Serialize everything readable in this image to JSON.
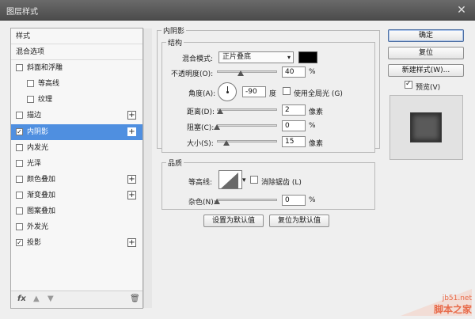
{
  "window": {
    "title": "图层样式",
    "close_icon": "close-icon"
  },
  "sidebar": {
    "items": [
      {
        "label": "样式",
        "has_checkbox": false,
        "checked": false,
        "has_plus": false
      },
      {
        "label": "混合选项",
        "has_checkbox": false,
        "checked": false,
        "has_plus": false
      },
      {
        "label": "斜面和浮雕",
        "has_checkbox": true,
        "checked": false,
        "has_plus": false
      },
      {
        "label": "等高线",
        "has_checkbox": true,
        "checked": false,
        "has_plus": false
      },
      {
        "label": "纹理",
        "has_checkbox": true,
        "checked": false,
        "has_plus": false
      },
      {
        "label": "描边",
        "has_checkbox": true,
        "checked": false,
        "has_plus": true
      },
      {
        "label": "内阴影",
        "has_checkbox": true,
        "checked": true,
        "has_plus": true
      },
      {
        "label": "内发光",
        "has_checkbox": true,
        "checked": false,
        "has_plus": false
      },
      {
        "label": "光泽",
        "has_checkbox": true,
        "checked": false,
        "has_plus": false
      },
      {
        "label": "颜色叠加",
        "has_checkbox": true,
        "checked": false,
        "has_plus": true
      },
      {
        "label": "渐变叠加",
        "has_checkbox": true,
        "checked": false,
        "has_plus": true
      },
      {
        "label": "图案叠加",
        "has_checkbox": true,
        "checked": false,
        "has_plus": false
      },
      {
        "label": "外发光",
        "has_checkbox": true,
        "checked": false,
        "has_plus": false
      },
      {
        "label": "投影",
        "has_checkbox": true,
        "checked": true,
        "has_plus": true
      }
    ],
    "footer": {
      "fx": "fx",
      "up": "▲",
      "down": "▼",
      "trash": "🗑"
    }
  },
  "inner_shadow": {
    "title": "内阴影",
    "structure_title": "结构",
    "blend_mode_label": "混合模式:",
    "blend_mode_value": "正片叠底",
    "blend_color": "#000000",
    "opacity_label": "不透明度(O):",
    "opacity_value": "40",
    "opacity_unit": "%",
    "opacity_fraction": 0.4,
    "angle_label": "角度(A):",
    "angle_value": "-90",
    "angle_unit": "度",
    "global_light_label": "使用全局光 (G)",
    "global_light_checked": false,
    "distance_label": "距离(D):",
    "distance_value": "2",
    "distance_unit": "像素",
    "choke_label": "阻塞(C):",
    "choke_value": "0",
    "choke_unit": "%",
    "size_label": "大小(S):",
    "size_value": "15",
    "size_unit": "像素",
    "quality_title": "品质",
    "contour_label": "等高线:",
    "antialias_label": "消除锯齿 (L)",
    "antialias_checked": false,
    "noise_label": "杂色(N):",
    "noise_value": "0",
    "noise_unit": "%",
    "set_default_label": "设置为默认值",
    "reset_default_label": "复位为默认值"
  },
  "actions": {
    "ok_label": "确定",
    "reset_label": "复位",
    "new_style_label": "新建样式(W)...",
    "preview_label": "预览(V)",
    "preview_checked": true
  },
  "watermark": {
    "url": "jb51.net",
    "name": "脚本之家"
  }
}
